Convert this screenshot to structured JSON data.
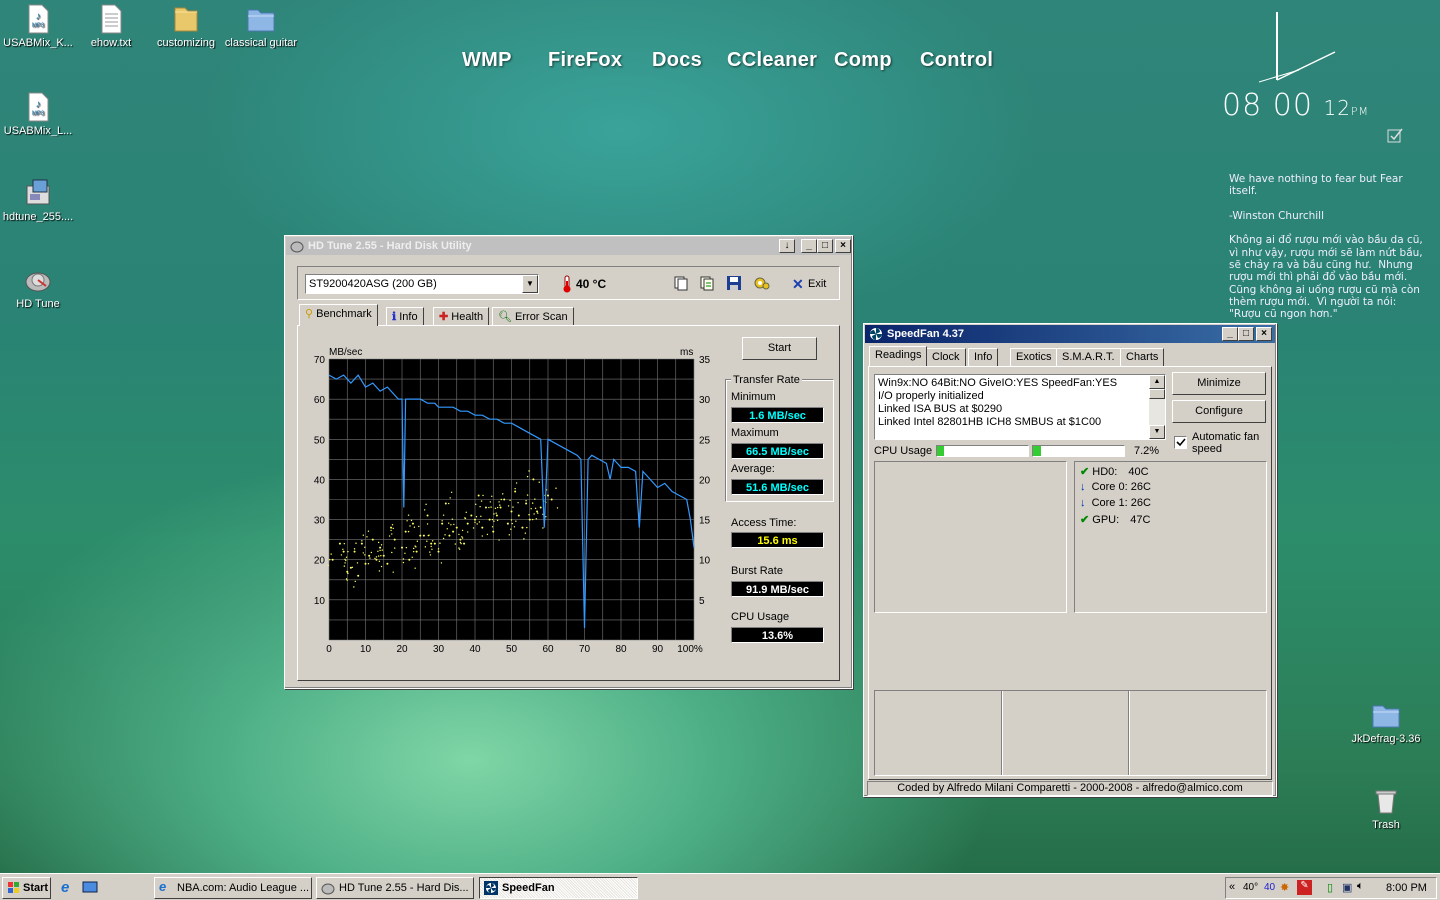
{
  "desktop_icons": [
    {
      "label": "USABMix_K...",
      "icon": "mp3-file-icon"
    },
    {
      "label": "ehow.txt",
      "icon": "text-file-icon"
    },
    {
      "label": "customizing",
      "icon": "folder-icon"
    },
    {
      "label": "classical guitar",
      "icon": "folder-icon"
    },
    {
      "label": "USABMix_L...",
      "icon": "mp3-file-icon"
    },
    {
      "label": "hdtune_255....",
      "icon": "installer-icon"
    },
    {
      "label": "HD Tune",
      "icon": "hdd-app-icon"
    },
    {
      "label": "JkDefrag-3.36",
      "icon": "folder-icon"
    },
    {
      "label": "Trash",
      "icon": "trash-icon"
    }
  ],
  "launcher": [
    "WMP",
    "FireFox",
    "Docs",
    "CCleaner",
    "Comp",
    "Control"
  ],
  "clock": {
    "hour": "08",
    "minute": "00",
    "second": "12",
    "ampm": "PM"
  },
  "quote": "We have nothing to fear but Fear itself.\n\n-Winston Churchill\n\nKhông ai đổ rượu mới vào bầu da cũ, vì như vậy, rượu mới sẽ làm nứt bầu, sẽ chảy ra và bầu cũng hư.  Nhưng rượu mới thì phải đổ vào bầu mới.\nCũng không ai uống rượu cũ mà còn thèm rượu mới.  Vì người ta nói: \"Rượu cũ ngon hơn.\"",
  "hdtune": {
    "title": "HD Tune 2.55 - Hard Disk Utility",
    "drive": "ST9200420ASG (200 GB)",
    "temperature": "40 °C",
    "exit_label": "Exit",
    "tabs": [
      "Benchmark",
      "Info",
      "Health",
      "Error Scan"
    ],
    "start_label": "Start",
    "transfer_rate_label": "Transfer Rate",
    "minimum_label": "Minimum",
    "minimum": "1.6 MB/sec",
    "maximum_label": "Maximum",
    "maximum": "66.5 MB/sec",
    "average_label": "Average:",
    "average": "51.6 MB/sec",
    "access_label": "Access Time:",
    "access": "15.6 ms",
    "burst_label": "Burst Rate",
    "burst": "91.9 MB/sec",
    "cpu_label": "CPU Usage",
    "cpu": "13.6%",
    "colors": {
      "transfer": "#3399ff",
      "access": "#ffff66",
      "lcd_text": "#00ffff",
      "access_lcd_text": "#ffff00"
    }
  },
  "chart_data": {
    "type": "line",
    "title": "",
    "xlabel": "",
    "ylabel": "MB/sec",
    "y2label": "ms",
    "x_ticks": [
      "0",
      "10",
      "20",
      "30",
      "40",
      "50",
      "60",
      "70",
      "80",
      "90",
      "100%"
    ],
    "y_ticks": [
      "70",
      "60",
      "50",
      "40",
      "30",
      "20",
      "10"
    ],
    "y2_ticks": [
      "35",
      "30",
      "25",
      "20",
      "15",
      "10",
      "5"
    ],
    "xlim": [
      0,
      100
    ],
    "ylim": [
      0,
      70
    ],
    "y2lim": [
      0,
      35
    ],
    "grid": true,
    "series": [
      {
        "x": [
          0,
          2,
          4,
          6,
          8,
          10,
          12,
          14,
          16,
          18,
          19,
          20,
          20.5,
          21,
          23,
          25,
          27,
          28,
          29,
          30,
          32,
          34,
          36,
          38,
          40,
          42,
          44,
          46,
          48,
          50,
          52,
          54,
          56,
          58,
          59,
          60,
          62,
          64,
          66,
          68,
          69,
          70,
          71,
          72,
          74,
          76,
          77,
          78,
          79,
          80,
          82,
          84,
          85,
          86,
          88,
          90,
          92,
          94,
          96,
          98,
          99,
          100
        ],
        "y": [
          66,
          65,
          66,
          64,
          66,
          63,
          64,
          62,
          63,
          61,
          60,
          60,
          33,
          60,
          60,
          60,
          59,
          59,
          59,
          58,
          58,
          58,
          57,
          57,
          56,
          56,
          55,
          55,
          54,
          54,
          53,
          52,
          51,
          50,
          28,
          50,
          49,
          48,
          47,
          46,
          45,
          3,
          45,
          46,
          45,
          44,
          40,
          45,
          44,
          43,
          43,
          42,
          28,
          42,
          40,
          38,
          39,
          37,
          36,
          35,
          30,
          23
        ]
      },
      {
        "x": [
          1,
          4,
          6,
          9,
          11,
          14,
          16,
          18,
          21,
          24,
          26,
          29,
          31,
          34,
          36,
          39,
          42,
          44,
          47,
          49,
          52,
          54,
          57,
          59,
          61,
          5,
          10,
          15,
          20,
          25,
          30,
          35,
          40,
          45,
          50,
          55,
          60,
          3,
          8,
          13,
          23,
          28,
          33,
          38,
          43,
          48,
          53,
          58,
          7,
          12,
          17,
          22,
          27,
          32,
          37,
          41,
          46,
          51,
          56
        ],
        "y": [
          20,
          22,
          18,
          24,
          21,
          23,
          19,
          25,
          27,
          22,
          26,
          24,
          29,
          27,
          25,
          31,
          28,
          30,
          33,
          29,
          31,
          34,
          32,
          30,
          35,
          17,
          19,
          21,
          23,
          26,
          22,
          28,
          30,
          27,
          32,
          30,
          36,
          24,
          16,
          20,
          29,
          24,
          26,
          29,
          33,
          35,
          28,
          33,
          22,
          25,
          28,
          20,
          31,
          34,
          24,
          36,
          31,
          37,
          40
        ]
      }
    ]
  },
  "speedfan": {
    "title": "SpeedFan 4.37",
    "tabs": [
      "Readings",
      "Clock",
      "Info",
      "Exotics",
      "S.M.A.R.T.",
      "Charts"
    ],
    "log": [
      "Win9x:NO  64Bit:NO  GiveIO:YES  SpeedFan:YES",
      "I/O properly initialized",
      "Linked ISA BUS at $0290",
      "Linked Intel 82801HB ICH8 SMBUS at $1C00"
    ],
    "minimize_label": "Minimize",
    "configure_label": "Configure",
    "auto_fan_label": "Automatic fan speed",
    "cpu_usage_label": "CPU Usage",
    "cpu_usage": "7.2%",
    "cpu_usage_fraction": 0.072,
    "temps": [
      {
        "name": "HD0:",
        "value": "40C",
        "status": "check-icon"
      },
      {
        "name": "Core 0:",
        "value": "26C",
        "status": "down-arrow-icon"
      },
      {
        "name": "Core 1:",
        "value": "26C",
        "status": "down-arrow-icon"
      },
      {
        "name": "GPU:",
        "value": "47C",
        "status": "check-icon"
      }
    ],
    "footer": "Coded by Alfredo Milani Comparetti - 2000-2008 - alfredo@almico.com"
  },
  "taskbar": {
    "start_label": "Start",
    "items": [
      "NBA.com: Audio League ...",
      "HD Tune 2.55 - Hard Dis...",
      "SpeedFan"
    ],
    "tray_temp": "40°",
    "tray_num": "40",
    "time": "8:00 PM"
  }
}
